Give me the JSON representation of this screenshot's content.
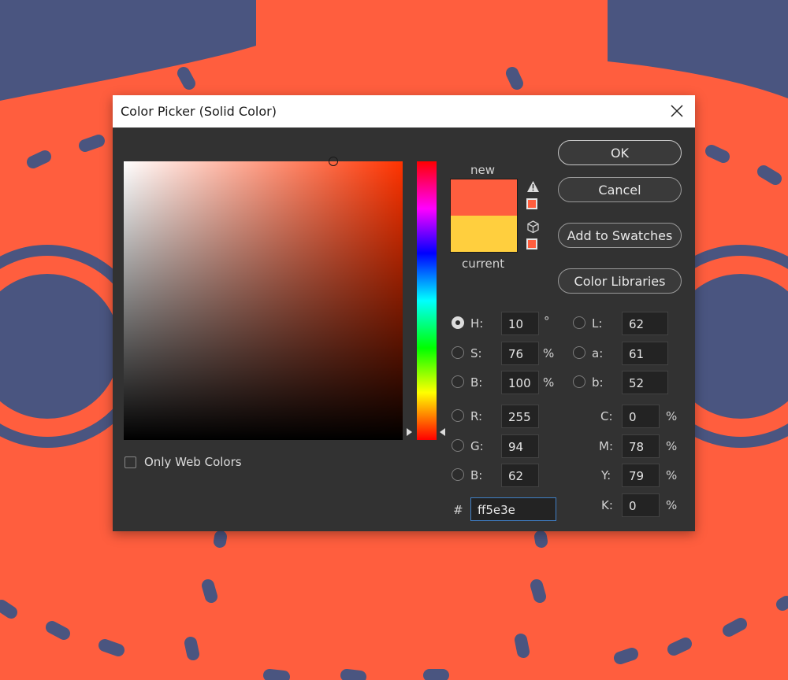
{
  "dialog": {
    "title": "Color Picker (Solid Color)",
    "close_icon": "close-icon"
  },
  "colors": {
    "background": "#ff5e3e",
    "background_shapes": "#4a5580",
    "dialog": "#323232",
    "new_color": "#ff5e3e",
    "current_color": "#ffcf3e",
    "hex_focus_border": "#3f7fc6"
  },
  "preview": {
    "new_label": "new",
    "current_label": "current",
    "gamut_warning_icon": "warning-triangle-icon",
    "web_safe_icon": "cube-icon"
  },
  "buttons": {
    "ok": "OK",
    "cancel": "Cancel",
    "add_to_swatches": "Add to Swatches",
    "color_libraries": "Color Libraries"
  },
  "fields": {
    "h": {
      "label": "H:",
      "value": "10",
      "unit": "°"
    },
    "s": {
      "label": "S:",
      "value": "76",
      "unit": "%"
    },
    "bright": {
      "label": "B:",
      "value": "100",
      "unit": "%"
    },
    "r": {
      "label": "R:",
      "value": "255"
    },
    "g": {
      "label": "G:",
      "value": "94"
    },
    "blue": {
      "label": "B:",
      "value": "62"
    },
    "l": {
      "label": "L:",
      "value": "62"
    },
    "a": {
      "label": "a:",
      "value": "61"
    },
    "lab_b": {
      "label": "b:",
      "value": "52"
    },
    "c": {
      "label": "C:",
      "value": "0",
      "unit": "%"
    },
    "m": {
      "label": "M:",
      "value": "78",
      "unit": "%"
    },
    "y": {
      "label": "Y:",
      "value": "79",
      "unit": "%"
    },
    "k": {
      "label": "K:",
      "value": "0",
      "unit": "%"
    },
    "hex": {
      "label": "#",
      "value": "ff5e3e"
    }
  },
  "only_web_colors": {
    "label": "Only Web Colors",
    "checked": false
  }
}
